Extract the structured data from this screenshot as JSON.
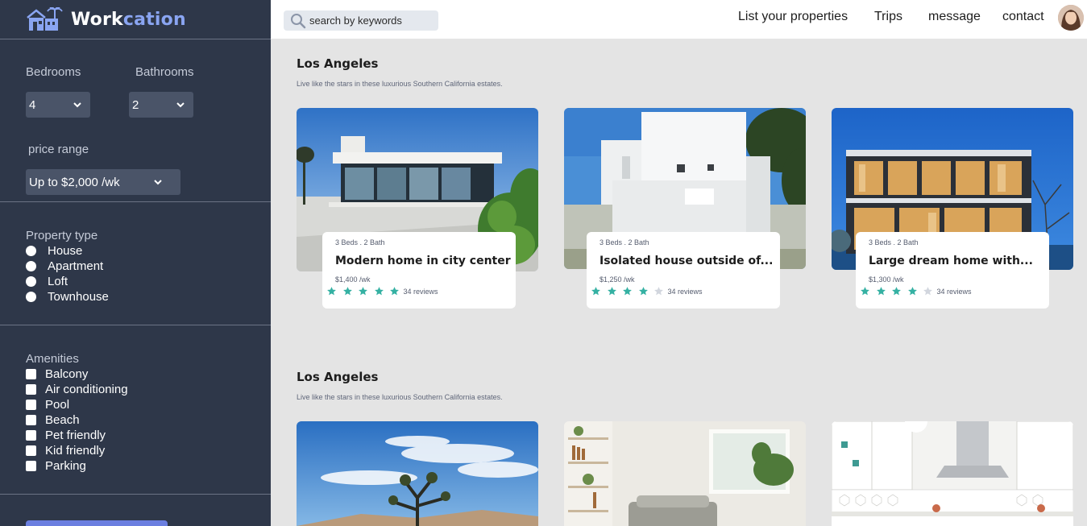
{
  "brand": {
    "name_part1": "Work",
    "name_part2": "cation"
  },
  "sidebar": {
    "bedrooms": {
      "label": "Bedrooms",
      "value": "4"
    },
    "bathrooms": {
      "label": "Bathrooms",
      "value": "2"
    },
    "price": {
      "label": "price range",
      "value": "Up to $2,000 /wk"
    },
    "property_type": {
      "title": "Property type",
      "options": [
        "House",
        "Apartment",
        "Loft",
        "Townhouse"
      ]
    },
    "amenities": {
      "title": "Amenities",
      "options": [
        "Balcony",
        "Air conditioning",
        "Pool",
        "Beach",
        "Pet friendly",
        "Kid friendly",
        "Parking"
      ]
    }
  },
  "header": {
    "search_placeholder": "search by keywords",
    "nav": [
      "List your properties",
      "Trips",
      "message",
      "contact"
    ]
  },
  "groups": [
    {
      "title": "Los Angeles",
      "subtitle": "Live like the stars in these luxurious Southern California estates.",
      "listings": [
        {
          "meta": "3 Beds . 2 Bath",
          "name": "Modern home in city center",
          "price": "$1,400 /wk",
          "rating": 5,
          "reviews": "34 reviews"
        },
        {
          "meta": "3 Beds . 2 Bath",
          "name": "Isolated house outside of...",
          "price": "$1,250 /wk",
          "rating": 4,
          "reviews": "34 reviews"
        },
        {
          "meta": "3 Beds . 2 Bath",
          "name": "Large dream home with...",
          "price": "$1,300 /wk",
          "rating": 4,
          "reviews": "34 reviews"
        }
      ]
    },
    {
      "title": "Los Angeles",
      "subtitle": "Live like the stars in these luxurious Southern California estates."
    }
  ],
  "colors": {
    "sidebar_bg": "#2e3749",
    "accent": "#8aa5f2",
    "star_filled": "#35b1a3",
    "star_empty": "#d2d6de",
    "button": "#6b7fe0"
  }
}
